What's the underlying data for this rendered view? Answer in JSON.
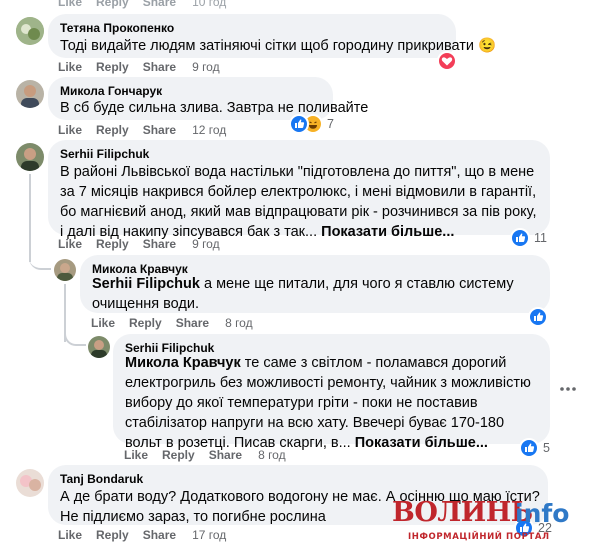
{
  "actions": {
    "like": "Like",
    "reply": "Reply",
    "share": "Share"
  },
  "top": {
    "like": "Like",
    "reply": "Reply",
    "share": "Share",
    "time": "10 год"
  },
  "comments": [
    {
      "author": "Тетяна Прокопенко",
      "text": "Тоді видайте людям затіняючі сітки щоб городину прикривати 😉",
      "time": "9 год"
    },
    {
      "author": "Микола Гончарук",
      "text": "В сб буде сильна злива. Завтра не поливайте",
      "time": "12 год",
      "reactions": "7"
    },
    {
      "author": "Serhii Filipchuk",
      "text": "В районі Львівської вода настільки \"підготовлена до пиття\", що в мене за 7 місяців накрився бойлер електролюкс, і мені відмовили в гарантії, бо магнієвий анод, який мав відпрацювати рік - розчинився за пів року, і далі від накипу зіпсувався бак з так...",
      "more": "Показати більше...",
      "time": "9 год",
      "reactions": "11"
    },
    {
      "author": "Микола Кравчук",
      "mention": "Serhii Filipchuk",
      "text": " а мене ще питали, для чого я ставлю систему очищення води.",
      "time": "8 год"
    },
    {
      "author": "Serhii Filipchuk",
      "mention": "Микола Кравчук",
      "text": " те саме з світлом - поламався дорогий електрогриль без можливості ремонту, чайник з можливістю вибору до якої температури гріти - поки не поставив стабілізатор напруги на всю хату. Ввечері буває 170-180 вольт в розетці. Писав скарги, в...",
      "more": "Показати більше...",
      "time": "8 год",
      "reactions": "5"
    },
    {
      "author": "Tanj Bondaruk",
      "text": "А де брати воду? Додаткового водогону не має. А осінню що маю їсти? Не підлиємо зараз, то погибне рослина",
      "time": "17 год",
      "reactions": "22"
    }
  ],
  "watermark": {
    "part1": "ВОЛИНЬ",
    "part2": "info",
    "sub": "ІНФОРМАЦІЙНИЙ ПОРТАЛ"
  },
  "colors": {
    "like_blue": "#1877f2",
    "heart_red": "#f33e58",
    "haha_yellow": "#f7b125",
    "meta_gray": "#65676b",
    "bubble": "#f0f2f5",
    "watermark_red": "#c0262c",
    "watermark_blue": "#2f79c7"
  },
  "icons": [
    "like-reaction-icon",
    "love-reaction-icon",
    "haha-reaction-icon",
    "more-options-icon"
  ]
}
